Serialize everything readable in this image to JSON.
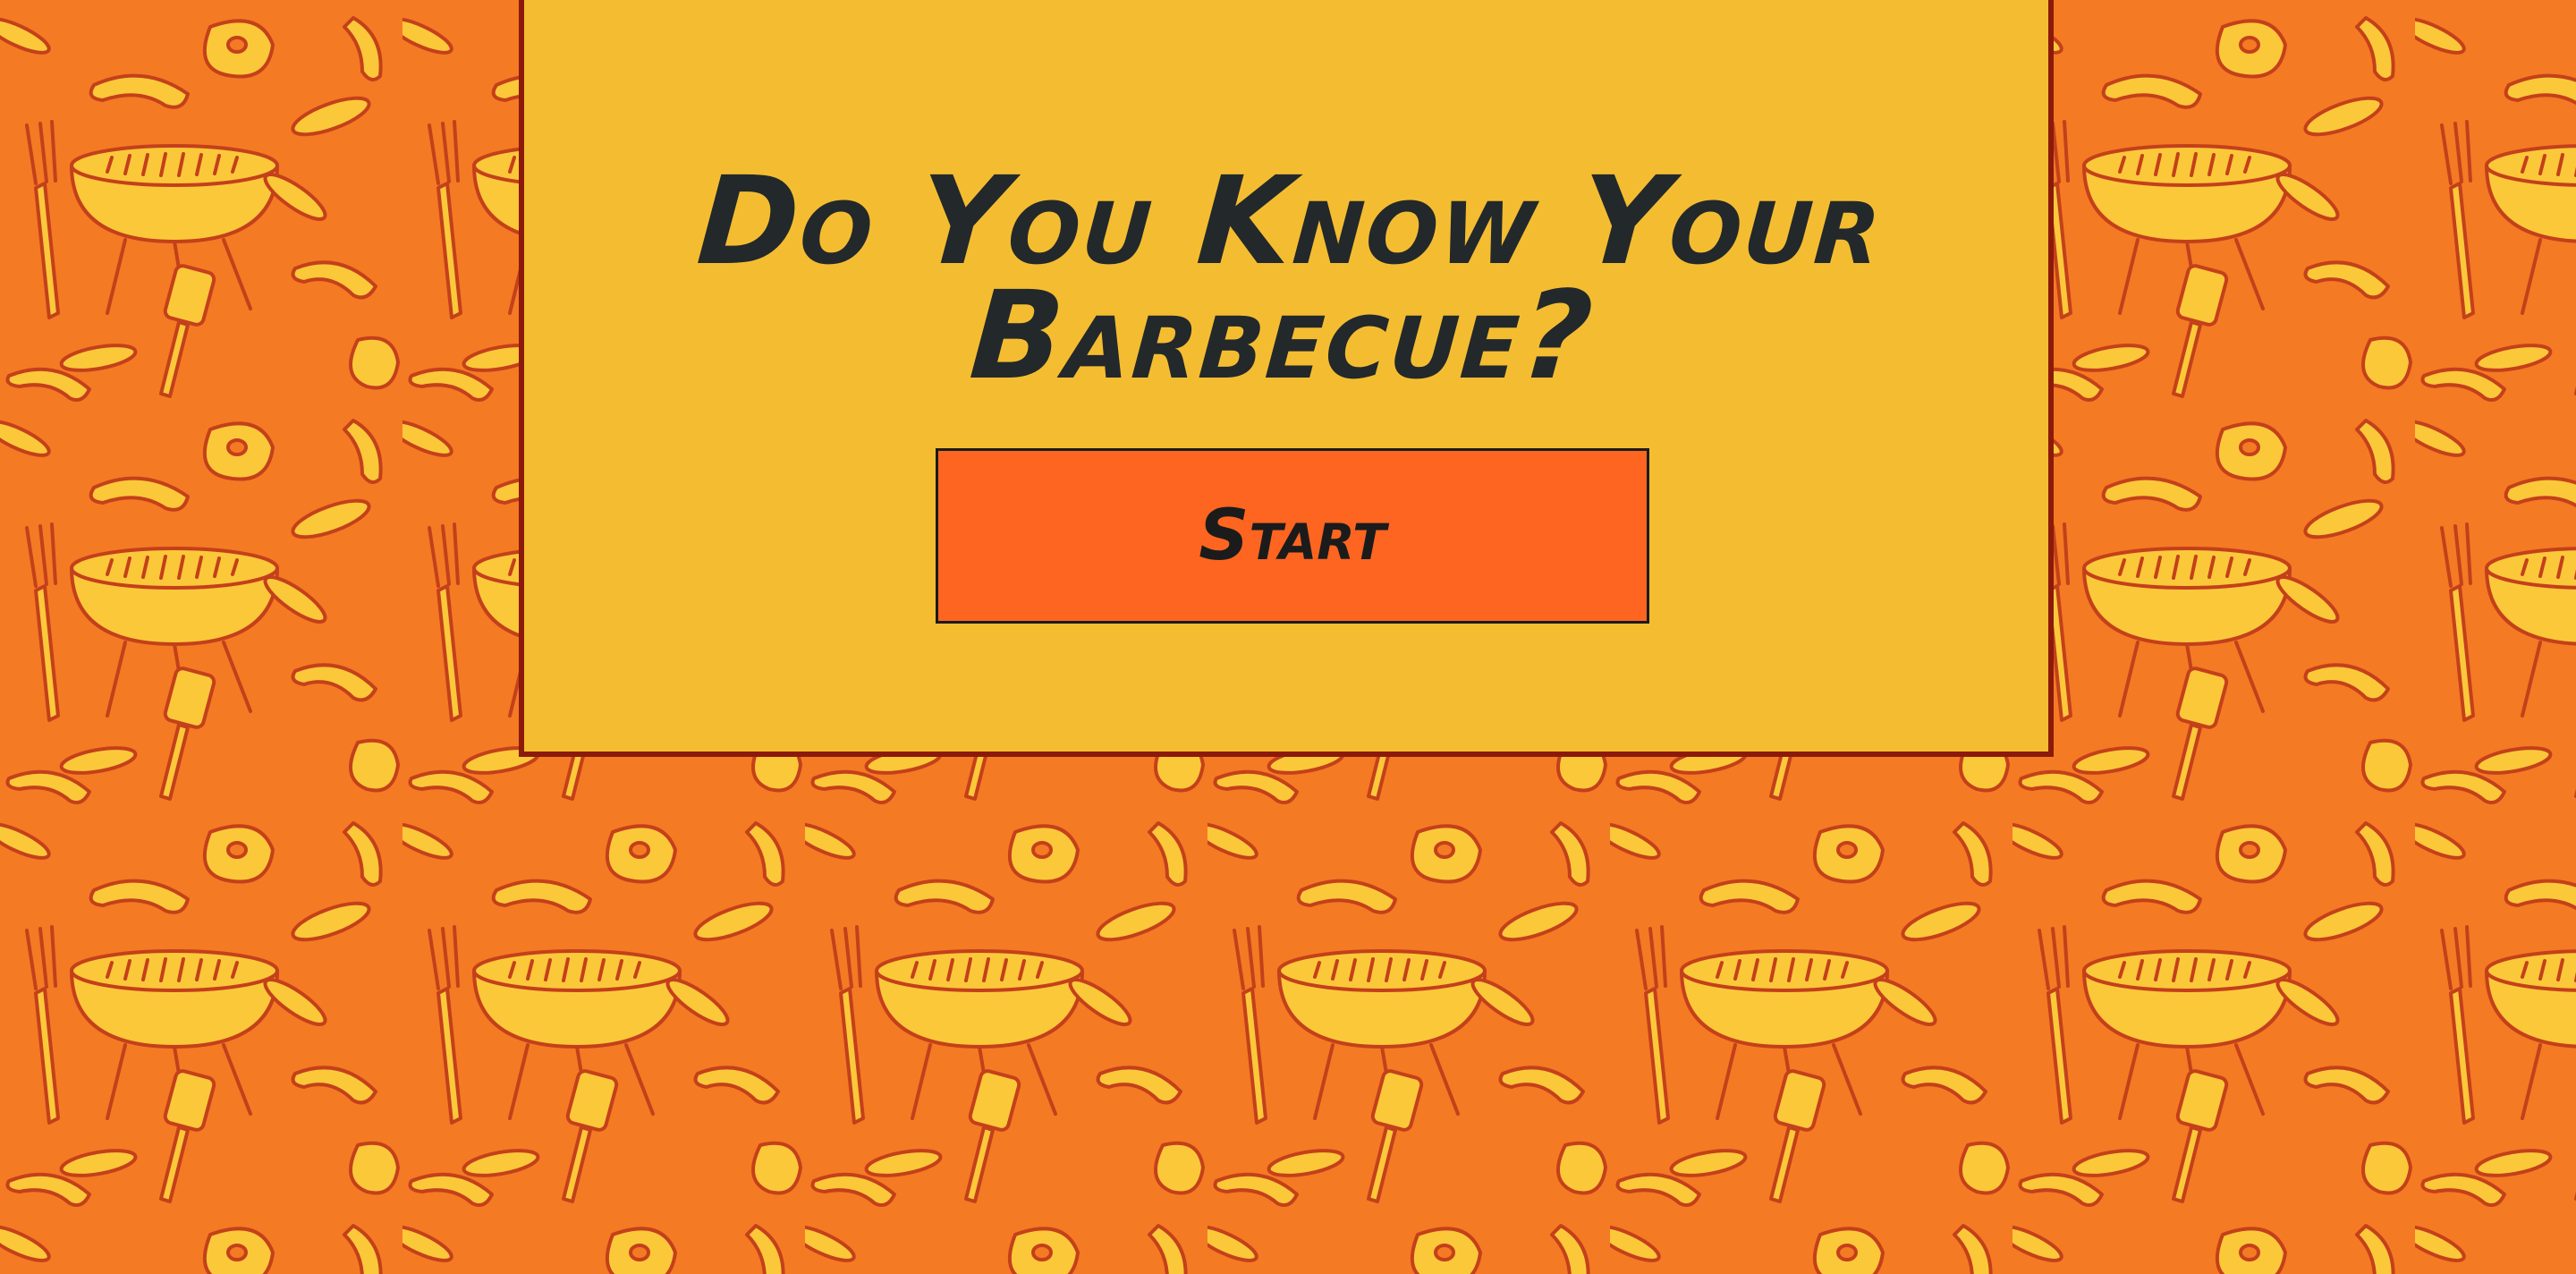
{
  "page": {
    "title": "Do You Know Your Barbecue?",
    "start_label": "Start"
  },
  "theme": {
    "background": "#f47a24",
    "pattern_fill": "#fbc83a",
    "pattern_stroke": "#c4401a",
    "card_background": "#f4bd31",
    "card_border": "#8c1a0a",
    "button_background": "#fd6520",
    "text_color": "#23282b"
  },
  "background_pattern": {
    "motifs": [
      "grill-icon",
      "sausage-icon",
      "fork-icon",
      "spatula-icon",
      "steak-icon",
      "patty-icon"
    ]
  }
}
